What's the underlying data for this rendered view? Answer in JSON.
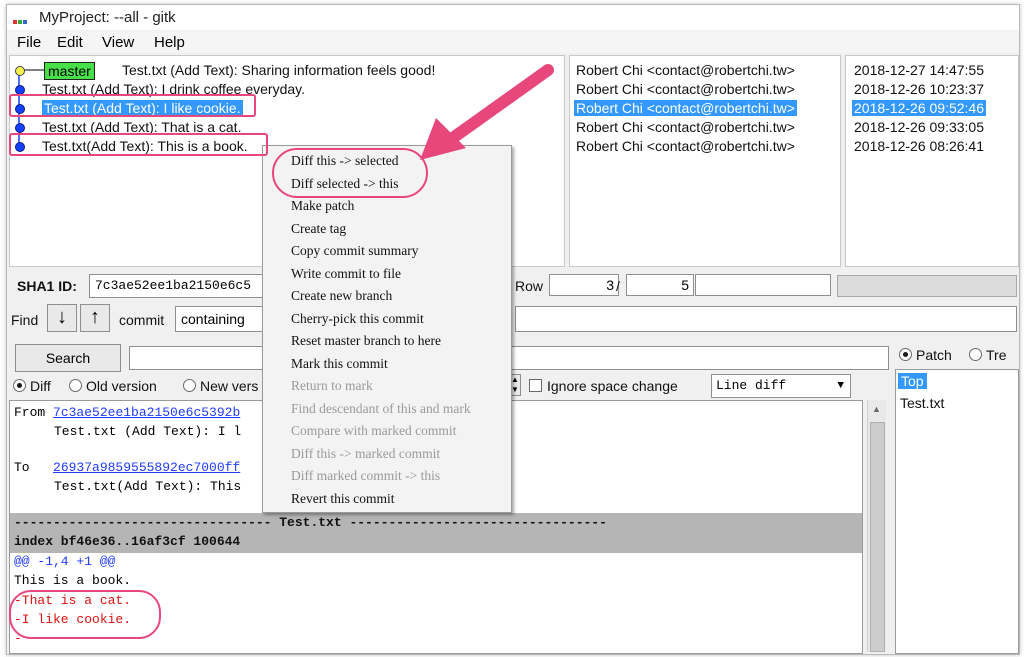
{
  "window": {
    "title": "MyProject: --all - gitk",
    "icon_name": "gitk-app-icon"
  },
  "menu": [
    "File",
    "Edit",
    "View",
    "Help"
  ],
  "history": {
    "branch_label": "master",
    "commits": [
      "Test.txt (Add Text): Sharing information feels good!",
      "Test.txt (Add Text): I drink coffee everyday.",
      "Test.txt (Add Text): I like cookie.",
      "Test.txt (Add Text): That is a cat.",
      "Test.txt(Add Text): This is a book."
    ],
    "authors": [
      "Robert Chi <contact@robertchi.tw>",
      "Robert Chi <contact@robertchi.tw>",
      "Robert Chi <contact@robertchi.tw>",
      "Robert Chi <contact@robertchi.tw>",
      "Robert Chi <contact@robertchi.tw>"
    ],
    "dates": [
      "2018-12-27 14:47:55",
      "2018-12-26 10:23:37",
      "2018-12-26 09:52:46",
      "2018-12-26 09:33:05",
      "2018-12-26 08:26:41"
    ],
    "selected_index": 2
  },
  "sha": {
    "label": "SHA1 ID:",
    "value": "7c3ae52ee1ba2150e6c5",
    "row_label": "Row",
    "row_current": "3",
    "row_sep": "/",
    "row_total": "5"
  },
  "find": {
    "label": "Find",
    "type_label": "commit",
    "mode_value": "containing"
  },
  "search": {
    "button": "Search"
  },
  "view_options": {
    "diff": "Diff",
    "old_version": "Old version",
    "new_version": "New vers",
    "ignore_space": "Ignore space change",
    "diff_mode": "Line diff",
    "patch": "Patch",
    "tree": "Tre"
  },
  "diff_view": {
    "from_label": "From",
    "from_sha": "7c3ae52ee1ba2150e6c5392b",
    "from_subject": "Test.txt (Add Text): I l",
    "to_label": "To",
    "to_sha": "26937a9859555892ec7000ff",
    "to_subject": "Test.txt(Add Text): This",
    "file_header": "--------------------------------- Test.txt ---------------------------------",
    "index_line": "index bf46e36..16af3cf 100644",
    "hunk": "@@ -1,4 +1 @@",
    "context_line": " This is a book.",
    "removed": [
      "-That is a cat.",
      "-I like cookie.",
      "-"
    ]
  },
  "files": {
    "items": [
      "Top",
      "Test.txt"
    ]
  },
  "context_menu": {
    "items": [
      {
        "label": "Diff this -> selected",
        "enabled": true
      },
      {
        "label": "Diff selected -> this",
        "enabled": true
      },
      {
        "label": "Make patch",
        "enabled": true
      },
      {
        "label": "Create tag",
        "enabled": true
      },
      {
        "label": "Copy commit summary",
        "enabled": true
      },
      {
        "label": "Write commit to file",
        "enabled": true
      },
      {
        "label": "Create new branch",
        "enabled": true
      },
      {
        "label": "Cherry-pick this commit",
        "enabled": true
      },
      {
        "label": "Reset master branch to here",
        "enabled": true
      },
      {
        "label": "Mark this commit",
        "enabled": true
      },
      {
        "label": "Return to mark",
        "enabled": false
      },
      {
        "label": "Find descendant of this and mark",
        "enabled": false
      },
      {
        "label": "Compare with marked commit",
        "enabled": false
      },
      {
        "label": "Diff this -> marked commit",
        "enabled": false
      },
      {
        "label": "Diff marked commit -> this",
        "enabled": false
      },
      {
        "label": "Revert this commit",
        "enabled": true
      }
    ]
  },
  "colors": {
    "selection": "#3399ff",
    "annotation": "#e8477b",
    "removed_text": "#e01010",
    "hunk_text": "#1f3cff",
    "branch_tag": "#48e048"
  }
}
